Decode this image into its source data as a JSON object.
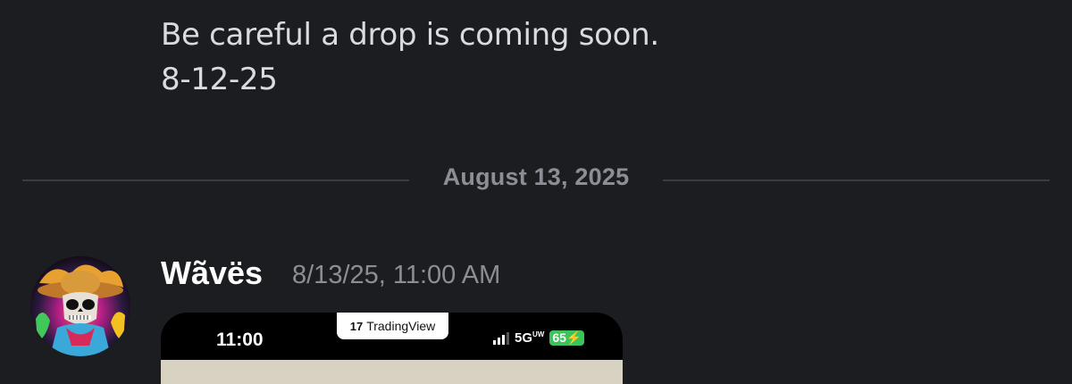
{
  "previous_message": {
    "lines": [
      "Be careful a drop is coming soon.",
      "8-12-25"
    ]
  },
  "date_divider": {
    "label": "August 13, 2025"
  },
  "message": {
    "author": "Wãvës",
    "timestamp": "8/13/25, 11:00 AM",
    "avatar_icon": "skull-cowboy-avatar"
  },
  "attachment": {
    "phone_time": "11:00",
    "app_logo": "17",
    "app_name": "TradingView",
    "network": "5G",
    "network_sup": "UW",
    "battery": "65",
    "battery_color": "#3cc35a"
  }
}
